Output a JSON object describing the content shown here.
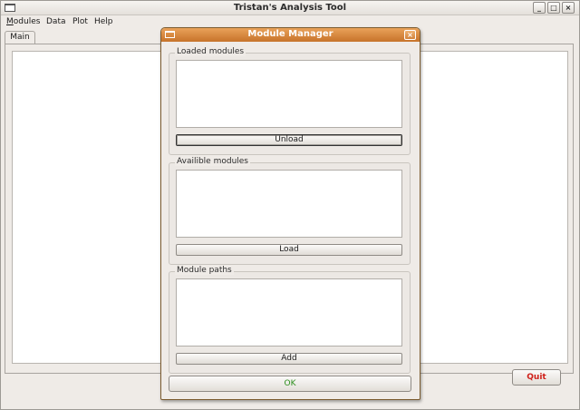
{
  "main_window": {
    "title": "Tristan's Analysis Tool",
    "controls": {
      "minimize": "_",
      "maximize": "□",
      "close": "×"
    },
    "menu": [
      {
        "mnemonic": "M",
        "rest": "odules"
      },
      {
        "mnemonic": "",
        "rest": "Data"
      },
      {
        "mnemonic": "",
        "rest": "Plot"
      },
      {
        "mnemonic": "",
        "rest": "Help"
      }
    ],
    "tabs": [
      {
        "label": "Main"
      }
    ],
    "quit_label": "Quit"
  },
  "dialog": {
    "title": "Module Manager",
    "close_glyph": "×",
    "groups": [
      {
        "label": "Loaded modules",
        "button": "Unload"
      },
      {
        "label": "Availible modules",
        "button": "Load"
      },
      {
        "label": "Module paths",
        "button": "Add"
      }
    ],
    "ok_label": "OK"
  },
  "colors": {
    "dialog_title_start": "#e9a25a",
    "dialog_title_end": "#c7732a",
    "quit_text": "#d0201a",
    "ok_text": "#2d8f1e"
  }
}
